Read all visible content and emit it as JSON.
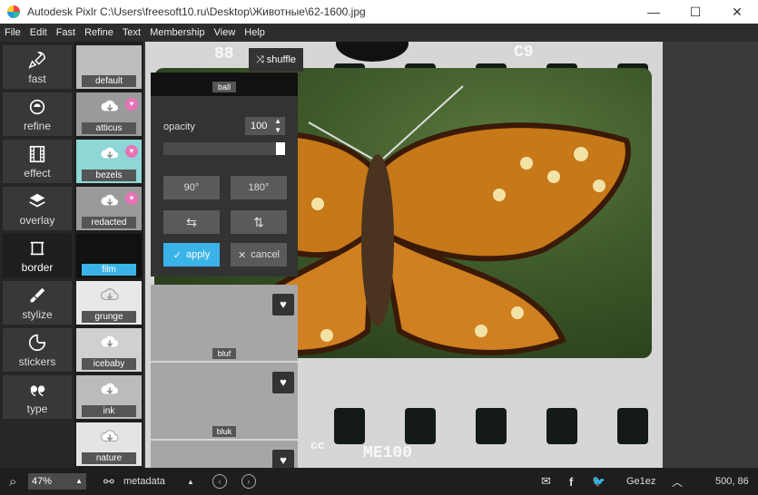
{
  "window": {
    "title": "Autodesk Pixlr   C:\\Users\\freesoft10.ru\\Desktop\\Животные\\62-1600.jpg",
    "minimize": "—",
    "maximize": "☐",
    "close": "✕"
  },
  "menu": [
    "File",
    "Edit",
    "Fast",
    "Refine",
    "Text",
    "Membership",
    "View",
    "Help"
  ],
  "tools": [
    {
      "label": "fast",
      "icon": "rocket-icon"
    },
    {
      "label": "refine",
      "icon": "refine-icon"
    },
    {
      "label": "effect",
      "icon": "film-icon"
    },
    {
      "label": "overlay",
      "icon": "layers-icon"
    },
    {
      "label": "border",
      "icon": "border-icon",
      "active": true
    },
    {
      "label": "stylize",
      "icon": "brush-icon"
    },
    {
      "label": "stickers",
      "icon": "sticker-icon"
    },
    {
      "label": "type",
      "icon": "quote-icon"
    }
  ],
  "border_thumbs": [
    {
      "label": "default"
    },
    {
      "label": "atticus",
      "heart": true
    },
    {
      "label": "bezels",
      "heart": true
    },
    {
      "label": "redacted",
      "heart": true
    },
    {
      "label": "film",
      "selected": true
    },
    {
      "label": "grunge"
    },
    {
      "label": "icebaby"
    },
    {
      "label": "ink"
    },
    {
      "label": "nature"
    }
  ],
  "panel": {
    "shuffle": "shuffle",
    "ball": "ball",
    "opacity_label": "opacity",
    "opacity_value": "100",
    "opacity_fraction": 1.0,
    "rot90": "90°",
    "rot180": "180°",
    "flip_h": "⇆",
    "flip_v": "⇅",
    "apply": "apply",
    "cancel": "cancel"
  },
  "overlays": [
    {
      "label": "bluf"
    },
    {
      "label": "bluk"
    }
  ],
  "film_text": {
    "top": "88",
    "right_top": "C9",
    "bottom_left": "cc",
    "bottom": "ME100"
  },
  "status": {
    "zoom": "47%",
    "metadata": "metadata",
    "username": "Ge1ez",
    "coords": "500, 86"
  }
}
